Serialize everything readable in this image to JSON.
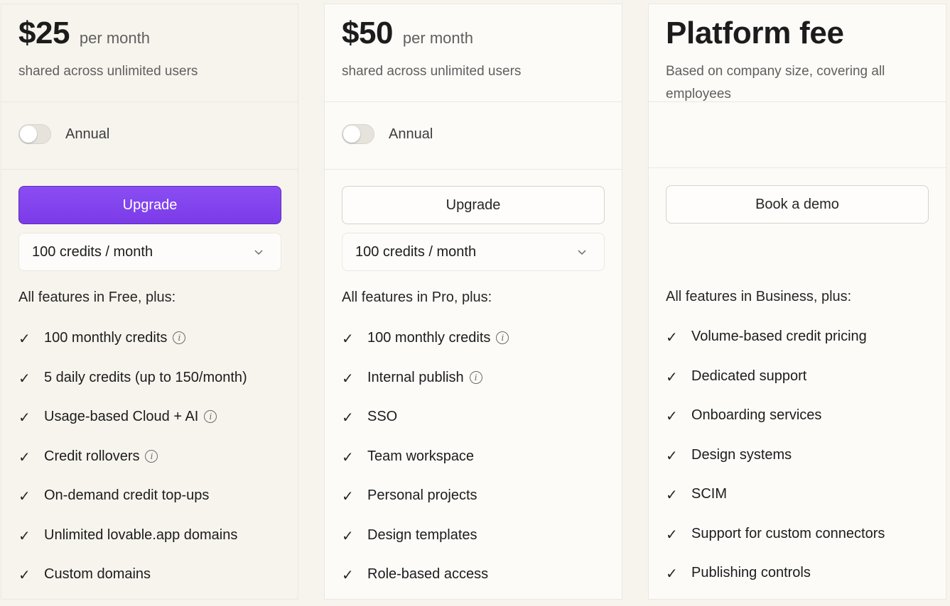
{
  "plans": [
    {
      "price": "$25",
      "period": "per month",
      "subtitle": "shared across unlimited users",
      "toggle_label": "Annual",
      "button_label": "Upgrade",
      "credits_select": "100 credits / month",
      "features_intro": "All features in Free, plus:",
      "features": [
        {
          "text": "100 monthly credits",
          "info": true
        },
        {
          "text": "5 daily credits (up to 150/month)",
          "info": false
        },
        {
          "text": "Usage-based Cloud + AI",
          "info": true
        },
        {
          "text": "Credit rollovers",
          "info": true
        },
        {
          "text": "On-demand credit top-ups",
          "info": false
        },
        {
          "text": "Unlimited lovable.app domains",
          "info": false
        },
        {
          "text": "Custom domains",
          "info": false
        }
      ]
    },
    {
      "price": "$50",
      "period": "per month",
      "subtitle": "shared across unlimited users",
      "toggle_label": "Annual",
      "button_label": "Upgrade",
      "credits_select": "100 credits / month",
      "features_intro": "All features in Pro, plus:",
      "features": [
        {
          "text": "100 monthly credits",
          "info": true
        },
        {
          "text": "Internal publish",
          "info": true
        },
        {
          "text": "SSO",
          "info": false
        },
        {
          "text": "Team workspace",
          "info": false
        },
        {
          "text": "Personal projects",
          "info": false
        },
        {
          "text": "Design templates",
          "info": false
        },
        {
          "text": "Role-based access",
          "info": false
        }
      ]
    },
    {
      "title": "Platform fee",
      "subtitle": "Based on company size, covering all employees",
      "button_label": "Book a demo",
      "features_intro": "All features in Business, plus:",
      "features": [
        {
          "text": "Volume-based credit pricing",
          "info": false
        },
        {
          "text": "Dedicated support",
          "info": false
        },
        {
          "text": "Onboarding services",
          "info": false
        },
        {
          "text": "Design systems",
          "info": false
        },
        {
          "text": "SCIM",
          "info": false
        },
        {
          "text": "Support for custom connectors",
          "info": false
        },
        {
          "text": "Publishing controls",
          "info": false
        }
      ]
    }
  ],
  "icons": {
    "check": "checkmark-icon",
    "info": "info-icon",
    "chevron": "chevron-down-icon"
  },
  "colors": {
    "accent": "#7b3be8",
    "card_bg": "#fcfbf8",
    "page_bg": "#f7f4ee"
  }
}
